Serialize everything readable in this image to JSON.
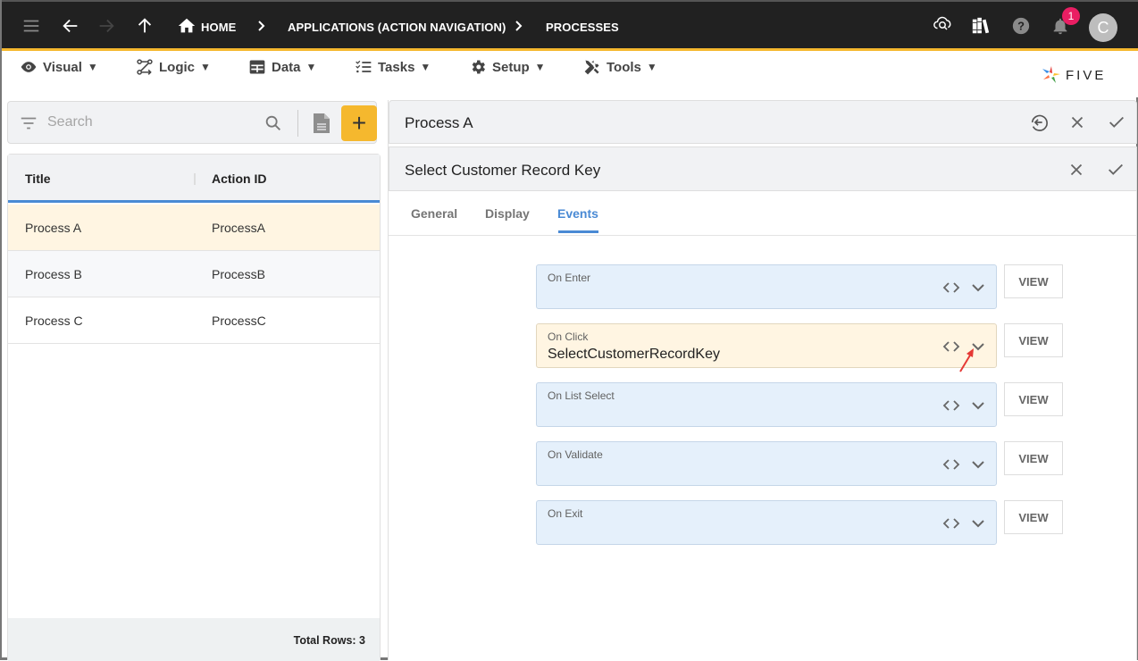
{
  "topbar": {
    "breadcrumbs": [
      {
        "label": "HOME",
        "icon": "home-icon"
      },
      {
        "label": "APPLICATIONS (ACTION NAVIGATION)"
      },
      {
        "label": "PROCESSES"
      }
    ],
    "notification_count": "1",
    "avatar_initial": "C",
    "icons": [
      "menu-icon",
      "back-arrow-icon",
      "forward-arrow-icon",
      "up-arrow-icon",
      "cloud-search-icon",
      "library-icon",
      "help-icon",
      "bell-icon"
    ]
  },
  "menubar": {
    "items": [
      {
        "label": "Visual",
        "icon": "eye-icon"
      },
      {
        "label": "Logic",
        "icon": "logic-flow-icon"
      },
      {
        "label": "Data",
        "icon": "table-icon"
      },
      {
        "label": "Tasks",
        "icon": "checklist-icon"
      },
      {
        "label": "Setup",
        "icon": "gear-icon"
      },
      {
        "label": "Tools",
        "icon": "tools-icon"
      }
    ],
    "caret": "▼",
    "logo_text": "FIVE"
  },
  "list": {
    "search_placeholder": "Search",
    "search_value": "",
    "add_label": "+",
    "columns": [
      "Title",
      "Action ID"
    ],
    "rows": [
      {
        "title": "Process A",
        "action_id": "ProcessA",
        "selected": true
      },
      {
        "title": "Process B",
        "action_id": "ProcessB",
        "selected": false
      },
      {
        "title": "Process C",
        "action_id": "ProcessC",
        "selected": false
      }
    ],
    "total_rows_label": "Total Rows: 3"
  },
  "record": {
    "title": "Process A",
    "sub_title": "Select Customer Record Key",
    "tabs": [
      {
        "label": "General",
        "active": false
      },
      {
        "label": "Display",
        "active": false
      },
      {
        "label": "Events",
        "active": true
      }
    ],
    "events": [
      {
        "label": "On Enter",
        "value": "",
        "view_label": "VIEW"
      },
      {
        "label": "On Click",
        "value": "SelectCustomerRecordKey",
        "view_label": "VIEW"
      },
      {
        "label": "On List Select",
        "value": "",
        "view_label": "VIEW"
      },
      {
        "label": "On Validate",
        "value": "",
        "view_label": "VIEW"
      },
      {
        "label": "On Exit",
        "value": "",
        "view_label": "VIEW"
      }
    ]
  },
  "colors": {
    "accent": "#f5b82e",
    "topbar": "#212121",
    "tab_active": "#4a8ad4",
    "selected_row": "#fff5e2",
    "event_field": "#e5f0fb",
    "badge": "#e91e63",
    "annotation_arrow": "#e53935"
  }
}
